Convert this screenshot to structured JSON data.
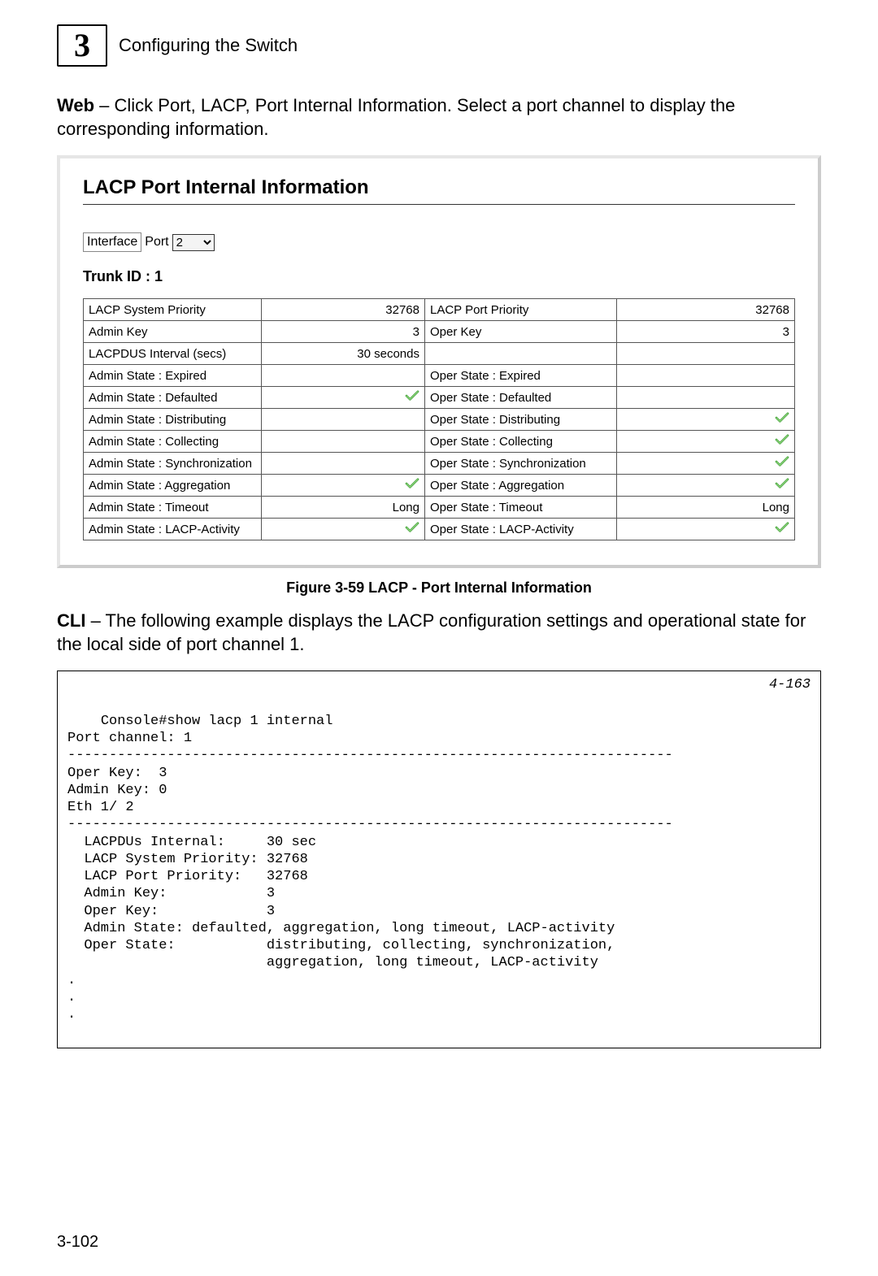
{
  "header": {
    "chapter_number": "3",
    "chapter_title": "Configuring the Switch"
  },
  "intro": {
    "web_prefix": "Web",
    "web_text": " – Click Port, LACP, Port Internal Information. Select a port channel to display the corresponding information."
  },
  "screenshot": {
    "heading": "LACP Port Internal Information",
    "interface_label": "Interface",
    "port_label": "Port",
    "port_value": "2",
    "trunk_label": "Trunk ID : 1",
    "rows": [
      {
        "l": "LACP System Priority",
        "lv": "32768",
        "r": "LACP Port Priority",
        "rv": "32768",
        "lvCheck": false,
        "rvCheck": false
      },
      {
        "l": "Admin Key",
        "lv": "3",
        "r": "Oper Key",
        "rv": "3",
        "lvCheck": false,
        "rvCheck": false
      },
      {
        "l": "LACPDUS Interval (secs)",
        "lv": "30 seconds",
        "r": "",
        "rv": "",
        "lvCheck": false,
        "rvCheck": false
      },
      {
        "l": "Admin State : Expired",
        "lv": "",
        "r": "Oper State : Expired",
        "rv": "",
        "lvCheck": false,
        "rvCheck": false
      },
      {
        "l": "Admin State : Defaulted",
        "lv": "",
        "r": "Oper State : Defaulted",
        "rv": "",
        "lvCheck": true,
        "rvCheck": false
      },
      {
        "l": "Admin State : Distributing",
        "lv": "",
        "r": "Oper State : Distributing",
        "rv": "",
        "lvCheck": false,
        "rvCheck": true
      },
      {
        "l": "Admin State : Collecting",
        "lv": "",
        "r": "Oper State : Collecting",
        "rv": "",
        "lvCheck": false,
        "rvCheck": true
      },
      {
        "l": "Admin State : Synchronization",
        "lv": "",
        "r": "Oper State : Synchronization",
        "rv": "",
        "lvCheck": false,
        "rvCheck": true
      },
      {
        "l": "Admin State : Aggregation",
        "lv": "",
        "r": "Oper State : Aggregation",
        "rv": "",
        "lvCheck": true,
        "rvCheck": true
      },
      {
        "l": "Admin State : Timeout",
        "lv": "Long",
        "r": "Oper State : Timeout",
        "rv": "Long",
        "lvCheck": false,
        "rvCheck": false
      },
      {
        "l": "Admin State : LACP-Activity",
        "lv": "",
        "r": "Oper State : LACP-Activity",
        "rv": "",
        "lvCheck": true,
        "rvCheck": true
      }
    ]
  },
  "figure_caption": "Figure 3-59   LACP - Port Internal Information",
  "cli": {
    "prefix": "CLI",
    "text": " – The following example displays the LACP configuration settings and operational state for the local side of port channel 1.",
    "reference": "4-163",
    "listing": "Console#show lacp 1 internal\nPort channel: 1\n-------------------------------------------------------------------------\nOper Key:  3\nAdmin Key: 0\nEth 1/ 2\n-------------------------------------------------------------------------\n  LACPDUs Internal:     30 sec\n  LACP System Priority: 32768\n  LACP Port Priority:   32768\n  Admin Key:            3\n  Oper Key:             3\n  Admin State: defaulted, aggregation, long timeout, LACP-activity\n  Oper State:           distributing, collecting, synchronization,\n                        aggregation, long timeout, LACP-activity\n.\n.\n."
  },
  "page_number": "3-102"
}
